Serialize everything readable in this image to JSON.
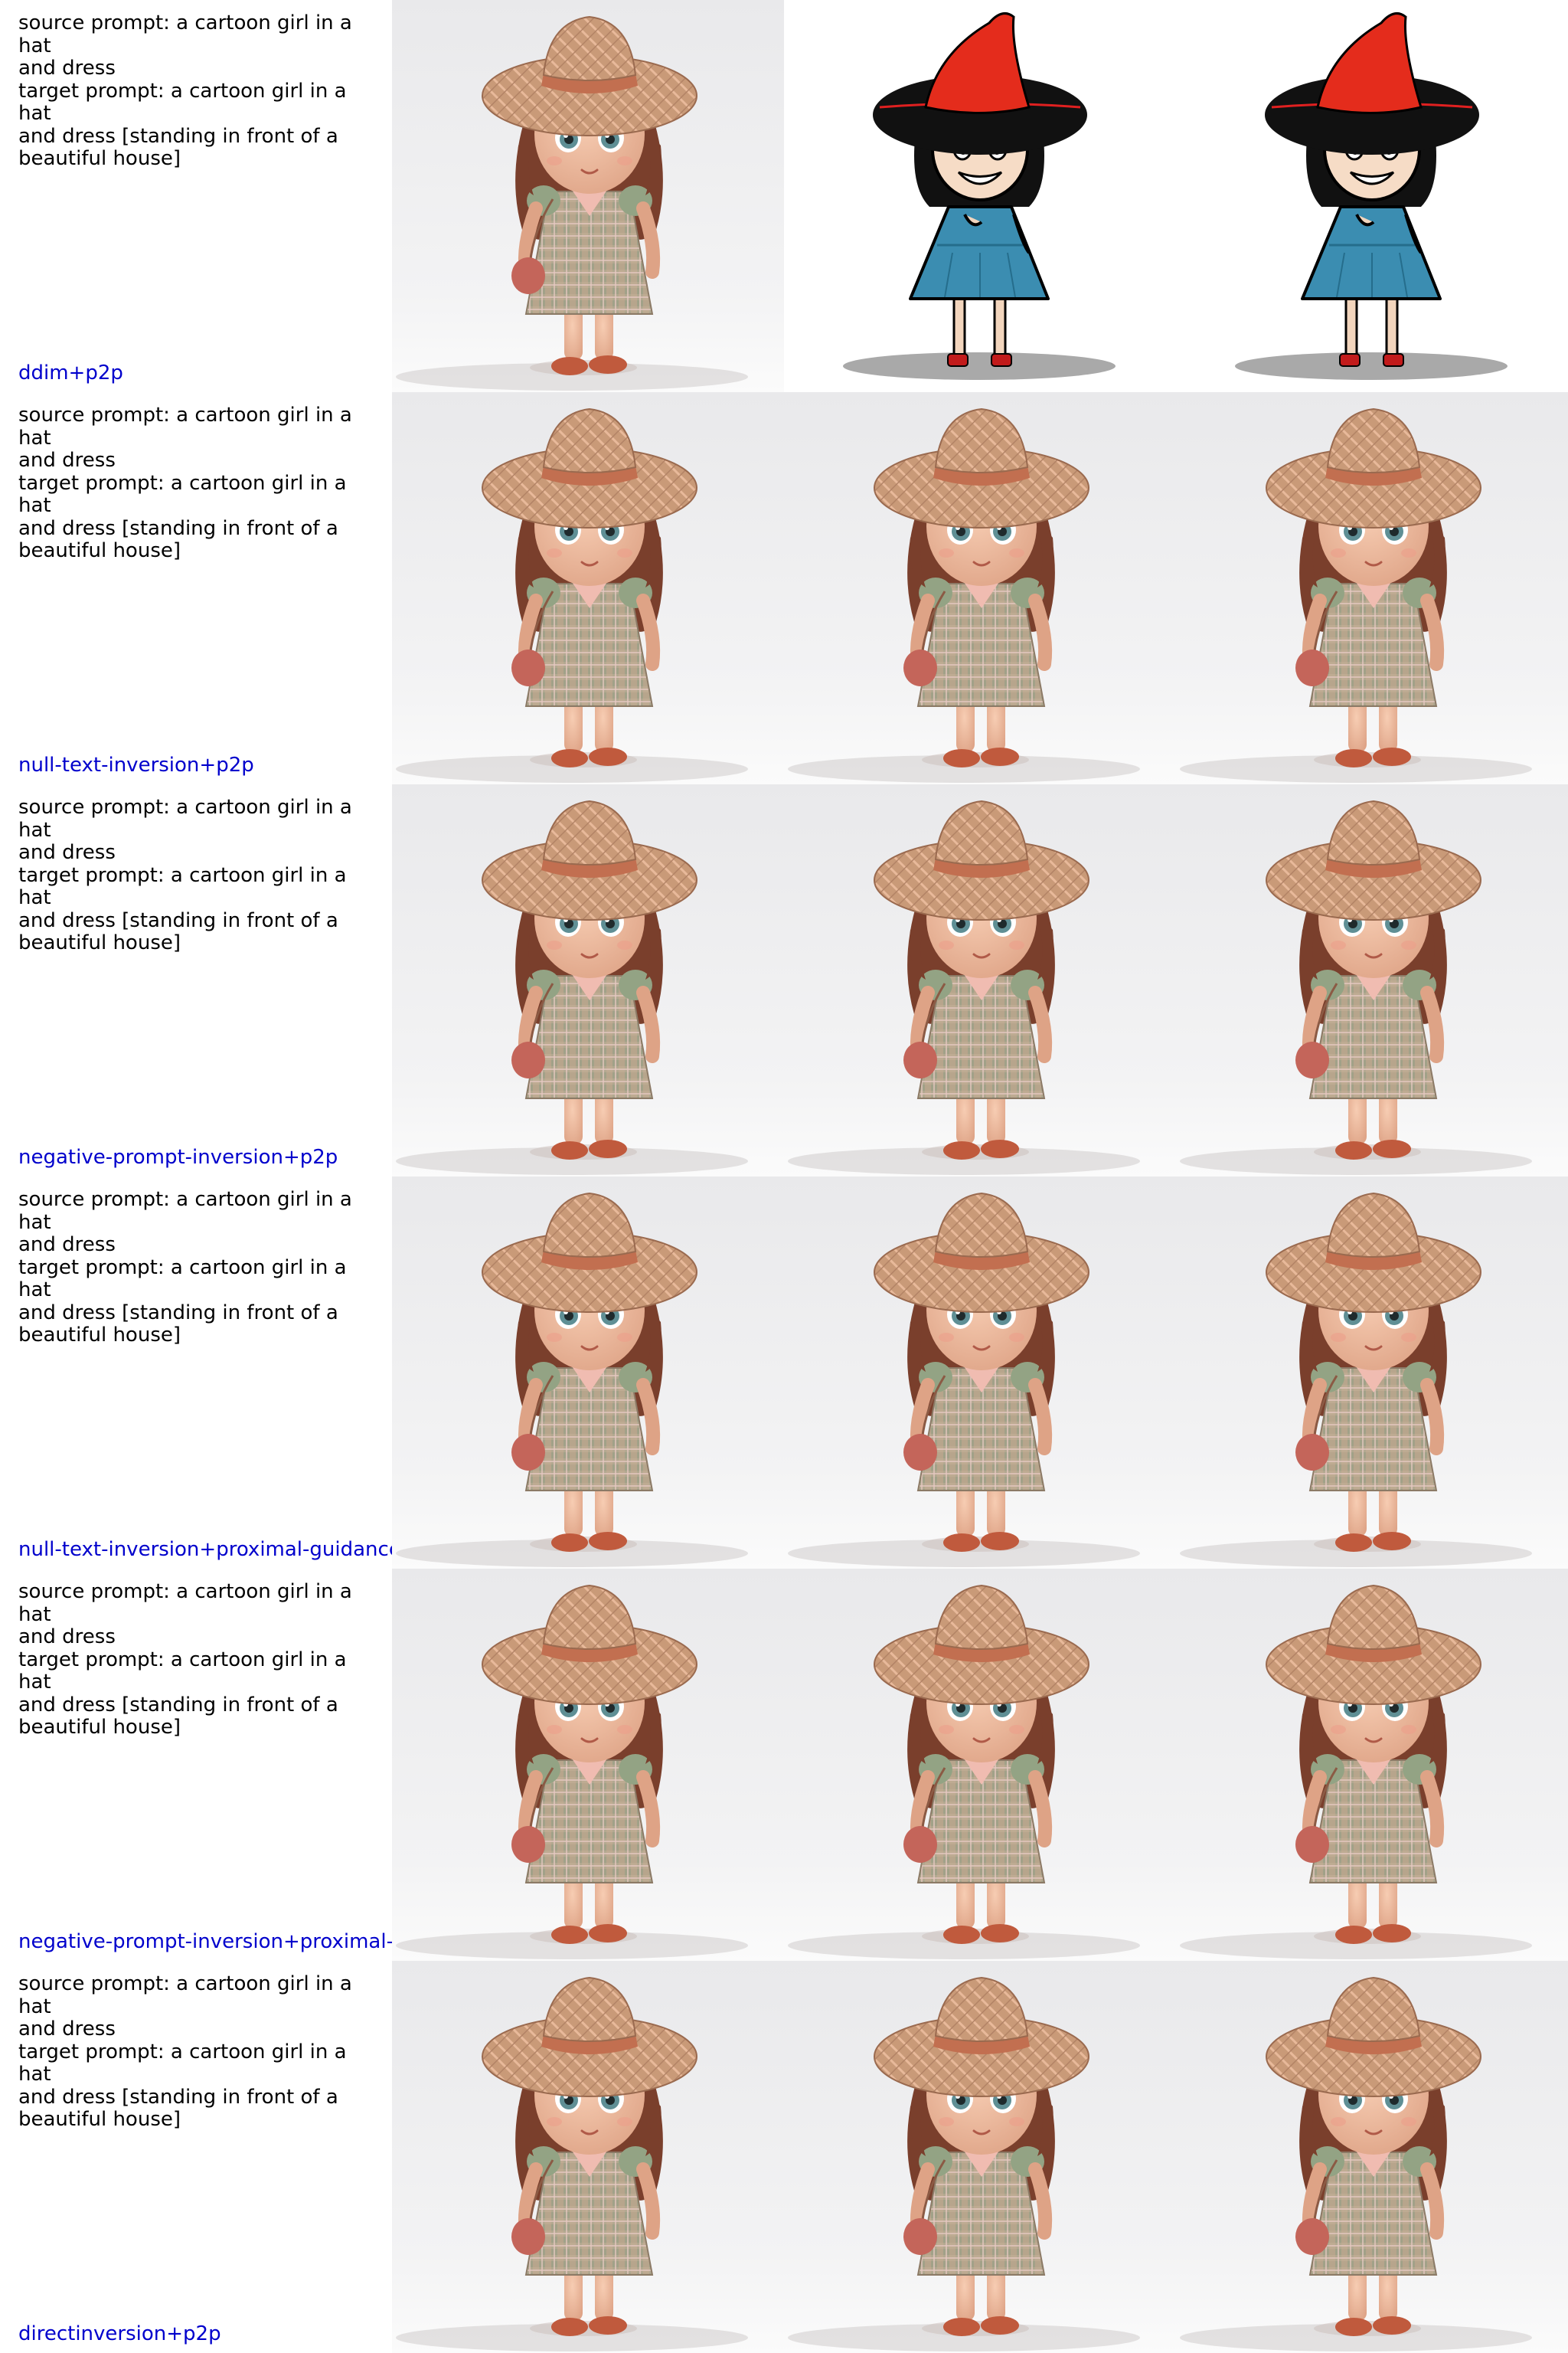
{
  "prompt_text": "source prompt: a cartoon girl in a hat\nand dress\ntarget prompt: a cartoon girl in a hat\nand dress [standing in front of a\nbeautiful house]",
  "rows": [
    {
      "method": "ddim+p2p",
      "images": [
        "3d-cartoon-girl-straw-hat-plaid-dress",
        "flat-cartoon-girl-red-witch-hat-blue-dress",
        "flat-cartoon-girl-red-witch-hat-blue-dress"
      ]
    },
    {
      "method": "null-text-inversion+p2p",
      "images": [
        "3d-cartoon-girl-straw-hat-plaid-dress",
        "3d-cartoon-girl-straw-hat-plaid-dress",
        "3d-cartoon-girl-straw-hat-plaid-dress"
      ]
    },
    {
      "method": "negative-prompt-inversion+p2p",
      "images": [
        "3d-cartoon-girl-straw-hat-plaid-dress",
        "3d-cartoon-girl-straw-hat-plaid-dress",
        "3d-cartoon-girl-straw-hat-plaid-dress"
      ]
    },
    {
      "method": "null-text-inversion+proximal-guidance",
      "images": [
        "3d-cartoon-girl-straw-hat-plaid-dress",
        "3d-cartoon-girl-straw-hat-plaid-dress",
        "3d-cartoon-girl-straw-hat-plaid-dress"
      ]
    },
    {
      "method": "negative-prompt-inversion+proximal-g",
      "images": [
        "3d-cartoon-girl-straw-hat-plaid-dress",
        "3d-cartoon-girl-straw-hat-plaid-dress",
        "3d-cartoon-girl-straw-hat-plaid-dress"
      ]
    },
    {
      "method": "directinversion+p2p",
      "images": [
        "3d-cartoon-girl-straw-hat-plaid-dress",
        "3d-cartoon-girl-straw-hat-plaid-dress",
        "3d-cartoon-girl-straw-hat-plaid-dress"
      ]
    }
  ],
  "colors": {
    "label_text": "#000000",
    "method_label": "#0000cc",
    "background": "#ffffff"
  }
}
